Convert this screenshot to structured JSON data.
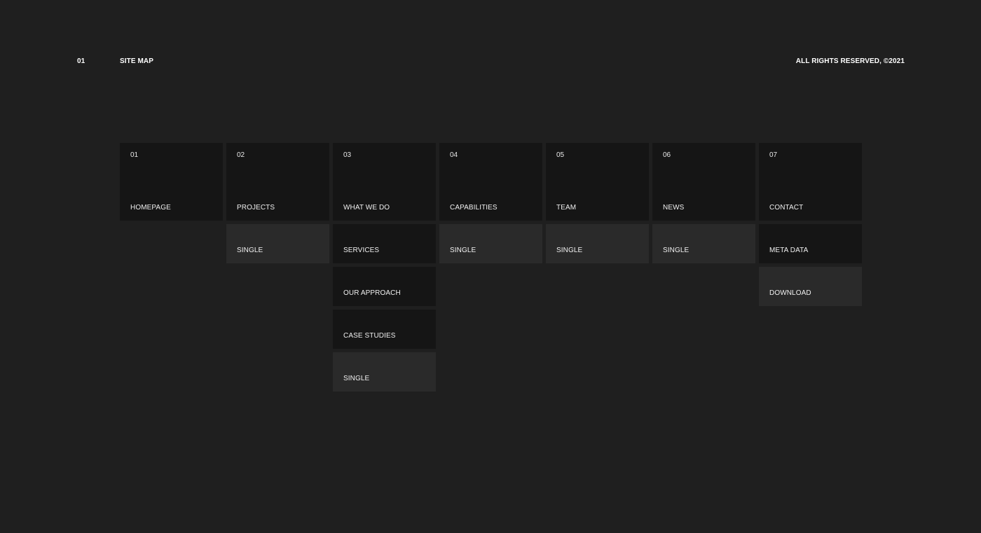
{
  "header": {
    "number": "01",
    "title": "SITE MAP",
    "rights": "ALL RIGHTS RESERVED, ©2021"
  },
  "colors": {
    "background": "#1f1f1f",
    "tile_dark": "#151515",
    "tile_light": "#2a2a2a",
    "text": "#f2f2f2"
  },
  "columns": [
    {
      "number": "01",
      "label": "HOMEPAGE",
      "children": []
    },
    {
      "number": "02",
      "label": "PROJECTS",
      "children": [
        {
          "label": "SINGLE",
          "tone": "light"
        }
      ]
    },
    {
      "number": "03",
      "label": "WHAT WE DO",
      "children": [
        {
          "label": "SERVICES",
          "tone": "dark"
        },
        {
          "label": "OUR APPROACH",
          "tone": "dark"
        },
        {
          "label": "CASE STUDIES",
          "tone": "dark"
        },
        {
          "label": "SINGLE",
          "tone": "light"
        }
      ]
    },
    {
      "number": "04",
      "label": "CAPABILITIES",
      "children": [
        {
          "label": "SINGLE",
          "tone": "light"
        }
      ]
    },
    {
      "number": "05",
      "label": "TEAM",
      "children": [
        {
          "label": "SINGLE",
          "tone": "light"
        }
      ]
    },
    {
      "number": "06",
      "label": "NEWS",
      "children": [
        {
          "label": "SINGLE",
          "tone": "light"
        }
      ]
    },
    {
      "number": "07",
      "label": "CONTACT",
      "children": [
        {
          "label": "META DATA",
          "tone": "dark"
        },
        {
          "label": "DOWNLOAD",
          "tone": "light"
        }
      ]
    }
  ]
}
